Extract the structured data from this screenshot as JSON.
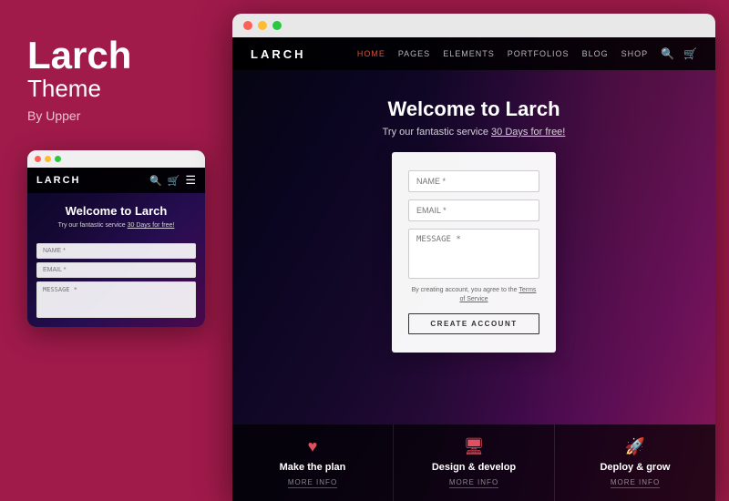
{
  "brand": {
    "title": "Larch",
    "subtitle": "Theme",
    "by": "By Upper"
  },
  "mobile": {
    "logo": "LARCH",
    "hero_heading": "Welcome to Larch",
    "hero_text": "Try our fantastic service",
    "hero_link": "30 Days for free!",
    "name_placeholder": "NAME *",
    "email_placeholder": "EMAIL *",
    "message_placeholder": "MESSAGE *"
  },
  "desktop": {
    "logo": "LARCH",
    "nav": {
      "home": "HOME",
      "pages": "PAGES",
      "elements": "ELEMENTS",
      "portfolios": "PORTFOLIOS",
      "blog": "BLOG",
      "shop": "SHOP"
    },
    "hero_heading": "Welcome to Larch",
    "hero_text": "Try our fantastic service",
    "hero_link": "30 Days for free!",
    "form": {
      "name_placeholder": "NAME *",
      "email_placeholder": "EMAIL *",
      "message_placeholder": "MESSAGE *",
      "tos_text": "By creating account, you agree to the",
      "tos_link": "Terms of Service",
      "button_label": "CREATE ACCOUNT"
    },
    "features": [
      {
        "icon": "♥",
        "title": "Make the plan",
        "more": "MORE INFO"
      },
      {
        "icon": "🖥",
        "title": "Design & develop",
        "more": "MORE INFO"
      },
      {
        "icon": "🚀",
        "title": "Deploy & grow",
        "more": "MORE INFO"
      }
    ]
  },
  "browser": {
    "dots": [
      "red",
      "yellow",
      "green"
    ]
  }
}
